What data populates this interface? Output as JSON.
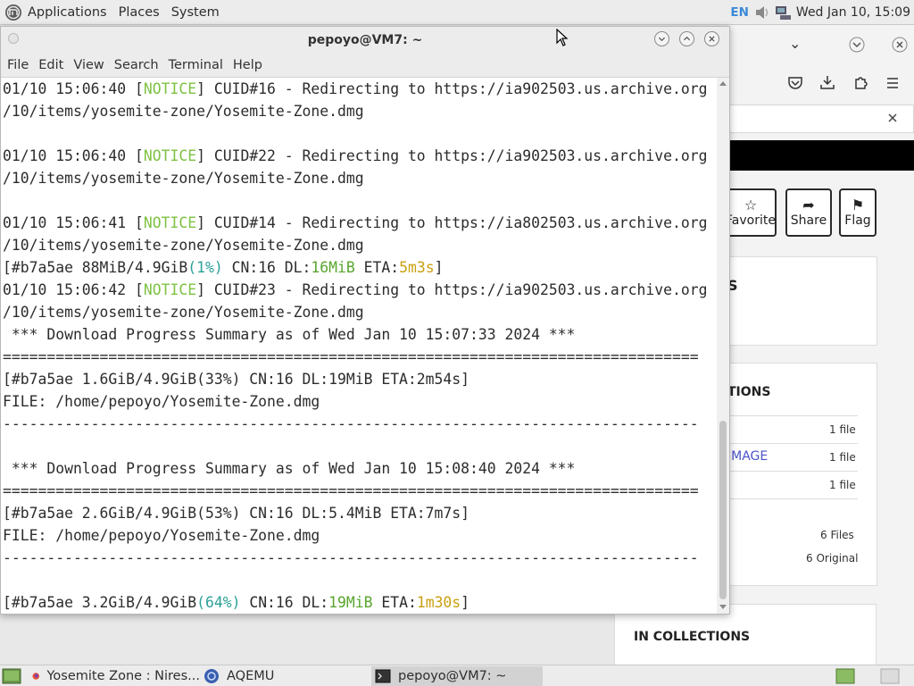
{
  "top_panel": {
    "menus": [
      "Applications",
      "Places",
      "System"
    ],
    "keyboard": "EN",
    "clock": "Wed Jan 10, 15:09"
  },
  "terminal": {
    "title": "pepoyo@VM7: ~",
    "menu": [
      "File",
      "Edit",
      "View",
      "Search",
      "Terminal",
      "Help"
    ],
    "lines": [
      [
        {
          "t": "01/10 15:06:40 ["
        },
        {
          "t": "NOTICE",
          "c": "notice"
        },
        {
          "t": "] CUID#16 - Redirecting to https://ia902503.us.archive.org"
        }
      ],
      [
        {
          "t": "/10/items/yosemite-zone/Yosemite-Zone.dmg"
        }
      ],
      [],
      [
        {
          "t": "01/10 15:06:40 ["
        },
        {
          "t": "NOTICE",
          "c": "notice"
        },
        {
          "t": "] CUID#22 - Redirecting to https://ia902503.us.archive.org"
        }
      ],
      [
        {
          "t": "/10/items/yosemite-zone/Yosemite-Zone.dmg"
        }
      ],
      [],
      [
        {
          "t": "01/10 15:06:41 ["
        },
        {
          "t": "NOTICE",
          "c": "notice"
        },
        {
          "t": "] CUID#14 - Redirecting to https://ia802503.us.archive.org"
        }
      ],
      [
        {
          "t": "/10/items/yosemite-zone/Yosemite-Zone.dmg"
        }
      ],
      [
        {
          "t": "[#b7a5ae 88MiB/4.9GiB"
        },
        {
          "t": "(1%)",
          "c": "cyan"
        },
        {
          "t": " CN:16 DL:"
        },
        {
          "t": "16MiB",
          "c": "green"
        },
        {
          "t": " ETA:"
        },
        {
          "t": "5m3s",
          "c": "yellow"
        },
        {
          "t": "]"
        }
      ],
      [
        {
          "t": "01/10 15:06:42 ["
        },
        {
          "t": "NOTICE",
          "c": "notice"
        },
        {
          "t": "] CUID#23 - Redirecting to https://ia902503.us.archive.org"
        }
      ],
      [
        {
          "t": "/10/items/yosemite-zone/Yosemite-Zone.dmg"
        }
      ],
      [
        {
          "t": " *** Download Progress Summary as of Wed Jan 10 15:07:33 2024 ***"
        }
      ],
      [
        {
          "t": "==============================================================================="
        }
      ],
      [
        {
          "t": "[#b7a5ae 1.6GiB/4.9GiB(33%) CN:16 DL:19MiB ETA:2m54s]"
        }
      ],
      [
        {
          "t": "FILE: /home/pepoyo/Yosemite-Zone.dmg"
        }
      ],
      [
        {
          "t": "-------------------------------------------------------------------------------"
        }
      ],
      [],
      [
        {
          "t": " *** Download Progress Summary as of Wed Jan 10 15:08:40 2024 ***"
        }
      ],
      [
        {
          "t": "==============================================================================="
        }
      ],
      [
        {
          "t": "[#b7a5ae 2.6GiB/4.9GiB(53%) CN:16 DL:5.4MiB ETA:7m7s]"
        }
      ],
      [
        {
          "t": "FILE: /home/pepoyo/Yosemite-Zone.dmg"
        }
      ],
      [
        {
          "t": "-------------------------------------------------------------------------------"
        }
      ],
      [],
      [
        {
          "t": "[#b7a5ae 3.2GiB/4.9GiB"
        },
        {
          "t": "(64%)",
          "c": "cyan"
        },
        {
          "t": " CN:16 DL:"
        },
        {
          "t": "19MiB",
          "c": "green"
        },
        {
          "t": " ETA:"
        },
        {
          "t": "1m30s",
          "c": "yellow"
        },
        {
          "t": "]"
        }
      ]
    ]
  },
  "browser": {
    "buttons": {
      "favorite": "Favorite",
      "share": "Share",
      "flag": "Flag"
    },
    "partial_s": "S",
    "sections": {
      "options": "TIONS",
      "in_collections": "IN COLLECTIONS"
    },
    "formats": [
      {
        "label": "",
        "count": "1 file"
      },
      {
        "label": "IMAGE",
        "count": "1 file"
      },
      {
        "label": "",
        "count": "1 file"
      }
    ],
    "totals": {
      "files": "6 Files",
      "original": "6 Original"
    }
  },
  "taskbar": {
    "items": [
      "Yosemite Zone : Nires...",
      "AQEMU",
      "pepoyo@VM7: ~"
    ]
  }
}
